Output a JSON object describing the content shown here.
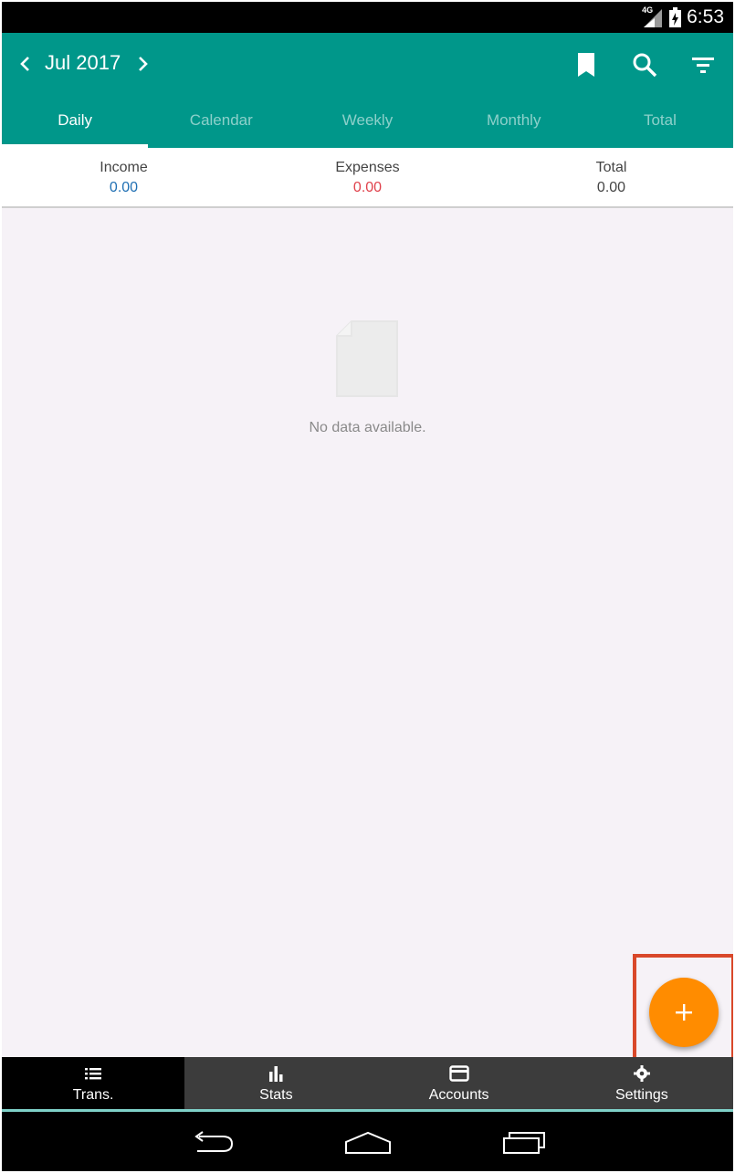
{
  "status_bar": {
    "network": "4G",
    "time": "6:53"
  },
  "header": {
    "month": "Jul 2017"
  },
  "tabs": [
    {
      "label": "Daily",
      "active": true
    },
    {
      "label": "Calendar",
      "active": false
    },
    {
      "label": "Weekly",
      "active": false
    },
    {
      "label": "Monthly",
      "active": false
    },
    {
      "label": "Total",
      "active": false
    }
  ],
  "summary": {
    "income_label": "Income",
    "income_value": "0.00",
    "expenses_label": "Expenses",
    "expenses_value": "0.00",
    "total_label": "Total",
    "total_value": "0.00"
  },
  "content": {
    "empty_message": "No data available."
  },
  "bottom_nav": [
    {
      "label": "Trans.",
      "icon": "list-icon",
      "active": true
    },
    {
      "label": "Stats",
      "icon": "bar-chart-icon",
      "active": false
    },
    {
      "label": "Accounts",
      "icon": "card-icon",
      "active": false
    },
    {
      "label": "Settings",
      "icon": "gear-icon",
      "active": false
    }
  ],
  "colors": {
    "primary": "#00978a",
    "fab": "#ff8c00",
    "income": "#1f6fb3",
    "expense": "#e0414b",
    "highlight": "#d9482a"
  }
}
